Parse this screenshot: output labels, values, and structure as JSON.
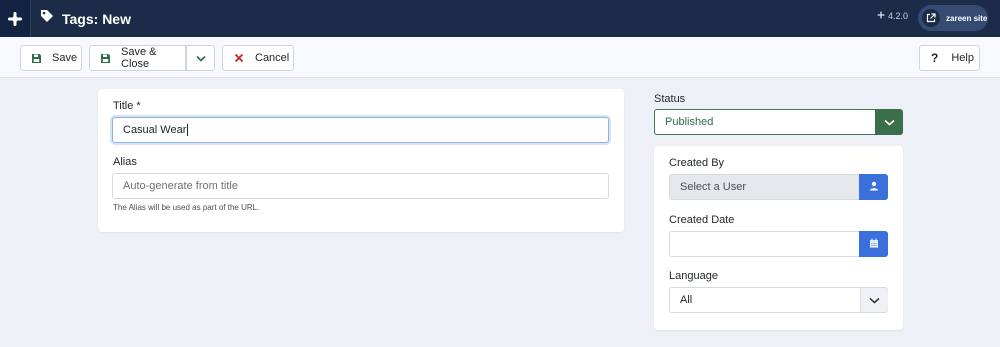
{
  "header": {
    "title": "Tags: New",
    "version": "4.2.0",
    "site_label": "zareen site"
  },
  "toolbar": {
    "save_label": "Save",
    "save_close_label": "Save & Close",
    "cancel_label": "Cancel",
    "help_label": "Help"
  },
  "form": {
    "title_label": "Title *",
    "title_value": "Casual Wear",
    "alias_label": "Alias",
    "alias_placeholder": "Auto-generate from title",
    "alias_hint": "The Alias will be used as part of the URL."
  },
  "sidebar": {
    "status_label": "Status",
    "status_value": "Published",
    "created_by_label": "Created By",
    "created_by_placeholder": "Select a User",
    "created_date_label": "Created Date",
    "created_date_value": "",
    "language_label": "Language",
    "language_value": "All"
  },
  "colors": {
    "header_bg": "#1c2b47",
    "status_green": "#3b6e4b",
    "accent_blue": "#3a70db",
    "page_bg": "#eef0f8"
  },
  "icons": {
    "logo": "joomla-logo-icon",
    "tag": "tag-icon",
    "external": "external-link-icon",
    "save": "floppy-disk-icon",
    "chevron": "chevron-down-icon",
    "cancel": "close-icon",
    "help": "question-icon",
    "user": "user-icon",
    "calendar": "calendar-icon"
  }
}
